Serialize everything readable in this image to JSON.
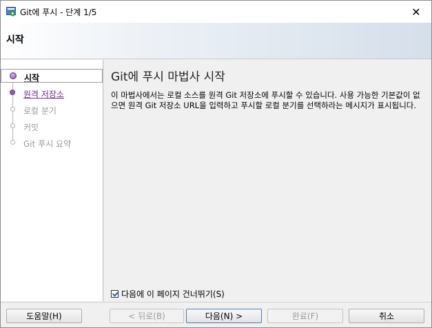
{
  "window": {
    "title": "Git에 푸시 - 단계 1/5",
    "close_glyph": "✕"
  },
  "header": {
    "title": "시작"
  },
  "nav": {
    "items": [
      {
        "label": "시작",
        "state": "active"
      },
      {
        "label": "원격 저장소",
        "state": "link"
      },
      {
        "label": "로컬 분기",
        "state": "disabled"
      },
      {
        "label": "커밋",
        "state": "disabled"
      },
      {
        "label": "Git 푸시 요약",
        "state": "disabled"
      }
    ]
  },
  "content": {
    "title": "Git에 푸시 마법사 시작",
    "description": "이 마법사에서는 로컬 소스를 원격 Git 저장소에 푸시할 수 있습니다. 사용 가능한 기본값이 없으면 원격 Git 저장소 URL을 입력하고 푸시할 로컬 분기를 선택하라는 메시지가 표시됩니다.",
    "skip_checkbox": {
      "label": "다음에 이 페이지 건너뛰기(S)",
      "checked": true
    }
  },
  "footer": {
    "help_label": "도움말(H)",
    "back_label": "< 뒤로(B)",
    "next_label": "다음(N) >",
    "finish_label": "완료(F)",
    "cancel_label": "취소"
  },
  "colors": {
    "accent": "#6b2c8f",
    "nav_disabled": "#9a9a9a",
    "link": "#6b2c8f"
  }
}
